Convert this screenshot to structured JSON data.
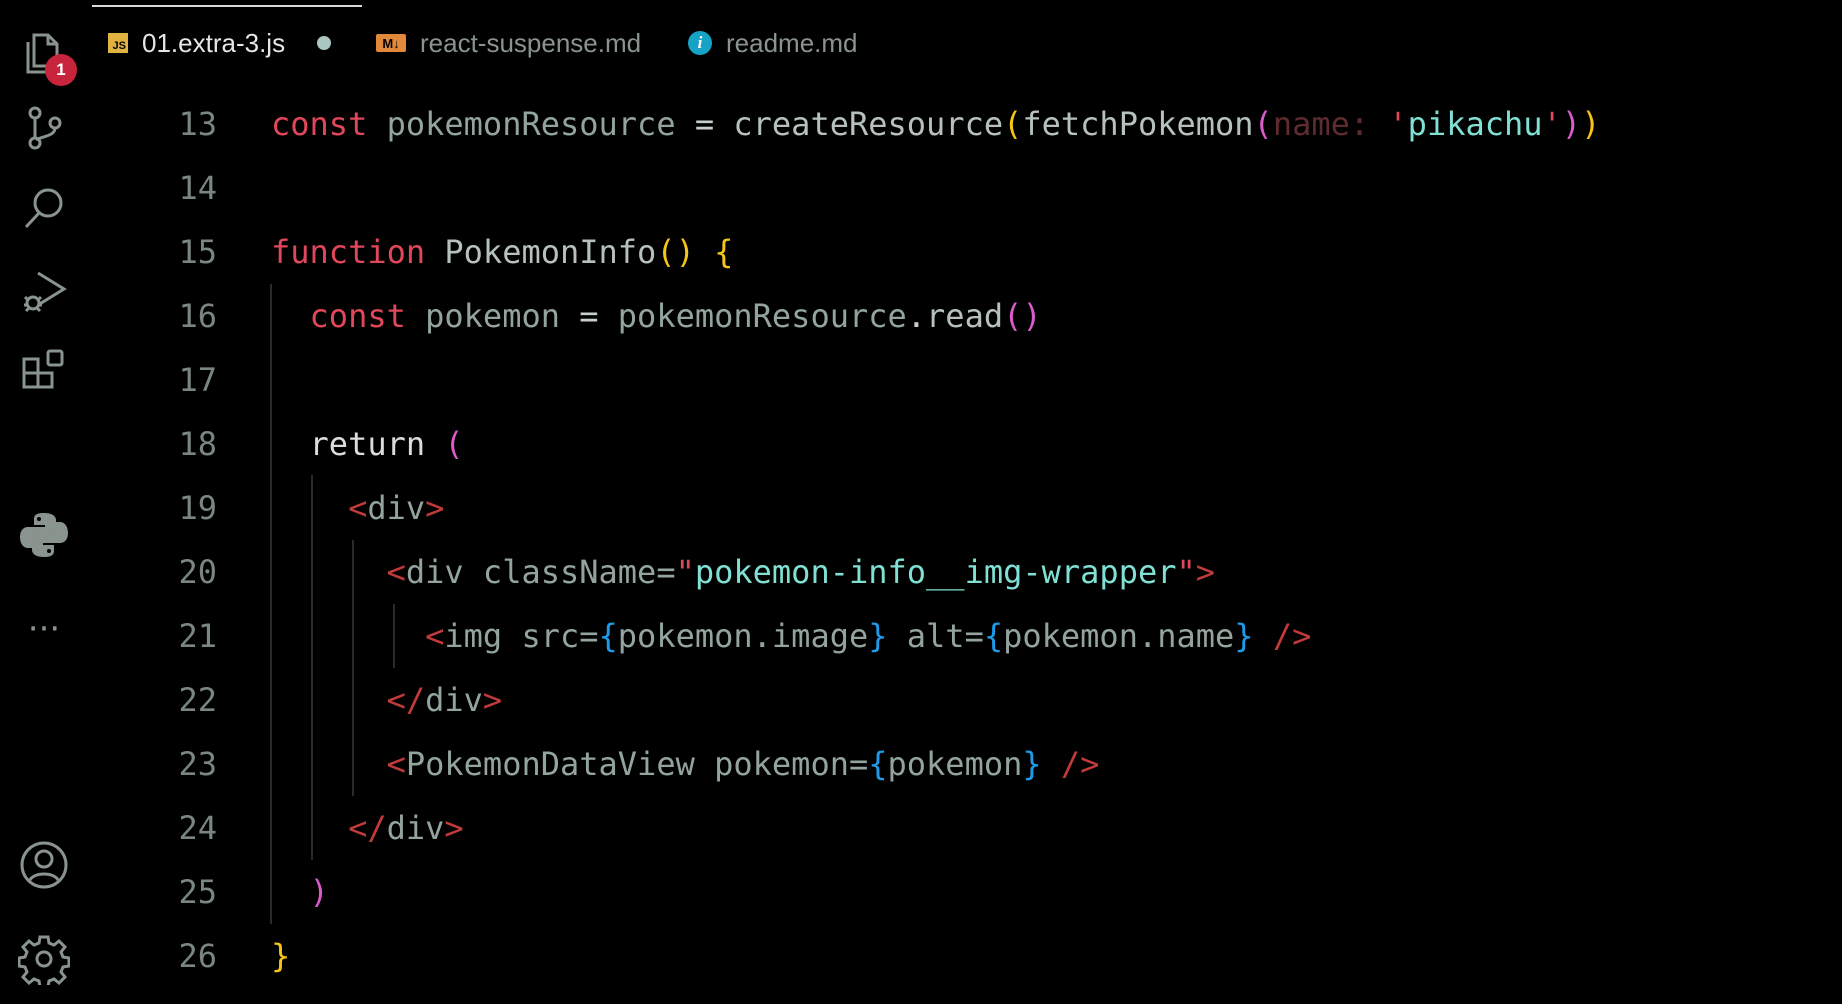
{
  "tabs": [
    {
      "label": "01.extra-3.js",
      "icon": "js-file-icon",
      "icon_text": "JS",
      "active": true,
      "dirty": true
    },
    {
      "label": "react-suspense.md",
      "icon": "markdown-file-icon",
      "icon_text": "M↓",
      "active": false
    },
    {
      "label": "readme.md",
      "icon": "info-file-icon",
      "icon_text": "i",
      "active": false
    }
  ],
  "activity": {
    "explorer_badge": "1",
    "icons": [
      "explorer-icon",
      "source-control-icon",
      "search-icon",
      "run-debug-icon",
      "extensions-icon",
      "python-icon",
      "more-icon",
      "account-icon",
      "settings-gear-icon"
    ],
    "more_label": "···"
  },
  "code_lines": [
    {
      "n": "13",
      "t": [
        [
          "kw",
          "const "
        ],
        [
          "id",
          "pokemonResource "
        ],
        [
          "op",
          "= "
        ],
        [
          "fn",
          "createResource"
        ],
        [
          "par-y",
          "("
        ],
        [
          "fn",
          "fetchPokemon"
        ],
        [
          "par-p",
          "("
        ],
        [
          "param",
          "name: "
        ],
        [
          "q",
          "'"
        ],
        [
          "str",
          "pikachu"
        ],
        [
          "q",
          "'"
        ],
        [
          "par-p",
          ")"
        ],
        [
          "par-y",
          ")"
        ]
      ]
    },
    {
      "n": "14",
      "t": []
    },
    {
      "n": "15",
      "t": [
        [
          "kw",
          "function "
        ],
        [
          "fn",
          "PokemonInfo"
        ],
        [
          "par-y",
          "() {"
        ]
      ]
    },
    {
      "n": "16",
      "t": [
        [
          "kw",
          "  const "
        ],
        [
          "id",
          "pokemon "
        ],
        [
          "op",
          "= "
        ],
        [
          "id",
          "pokemonResource"
        ],
        [
          "op",
          "."
        ],
        [
          "fn",
          "read"
        ],
        [
          "par-p",
          "()"
        ]
      ]
    },
    {
      "n": "17",
      "t": []
    },
    {
      "n": "18",
      "t": [
        [
          "ret",
          "  return "
        ],
        [
          "par-p",
          "("
        ]
      ]
    },
    {
      "n": "19",
      "t": [
        [
          "tag",
          "    <"
        ],
        [
          "tagname",
          "div"
        ],
        [
          "tag",
          ">"
        ]
      ]
    },
    {
      "n": "20",
      "t": [
        [
          "tag",
          "      <"
        ],
        [
          "tagname",
          "div "
        ],
        [
          "attr",
          "className="
        ],
        [
          "q",
          "\""
        ],
        [
          "str",
          "pokemon-info__img-wrapper"
        ],
        [
          "q",
          "\""
        ],
        [
          "tag",
          ">"
        ]
      ]
    },
    {
      "n": "21",
      "t": [
        [
          "tag",
          "        <"
        ],
        [
          "tagname",
          "img "
        ],
        [
          "attr",
          "src="
        ],
        [
          "par-b",
          "{"
        ],
        [
          "id",
          "pokemon.image"
        ],
        [
          "par-b",
          "}"
        ],
        [
          "attr",
          " alt="
        ],
        [
          "par-b",
          "{"
        ],
        [
          "id",
          "pokemon.name"
        ],
        [
          "par-b",
          "}"
        ],
        [
          "tag",
          " />"
        ]
      ]
    },
    {
      "n": "22",
      "t": [
        [
          "tag",
          "      </"
        ],
        [
          "tagname",
          "div"
        ],
        [
          "tag",
          ">"
        ]
      ]
    },
    {
      "n": "23",
      "t": [
        [
          "tag",
          "      <"
        ],
        [
          "tagname",
          "PokemonDataView "
        ],
        [
          "attr",
          "pokemon="
        ],
        [
          "par-b",
          "{"
        ],
        [
          "id",
          "pokemon"
        ],
        [
          "par-b",
          "}"
        ],
        [
          "tag",
          " />"
        ]
      ]
    },
    {
      "n": "24",
      "t": [
        [
          "tag",
          "    </"
        ],
        [
          "tagname",
          "div"
        ],
        [
          "tag",
          ">"
        ]
      ]
    },
    {
      "n": "25",
      "t": [
        [
          "par-p",
          "  )"
        ]
      ]
    },
    {
      "n": "26",
      "t": [
        [
          "par-y",
          "}"
        ]
      ]
    }
  ]
}
